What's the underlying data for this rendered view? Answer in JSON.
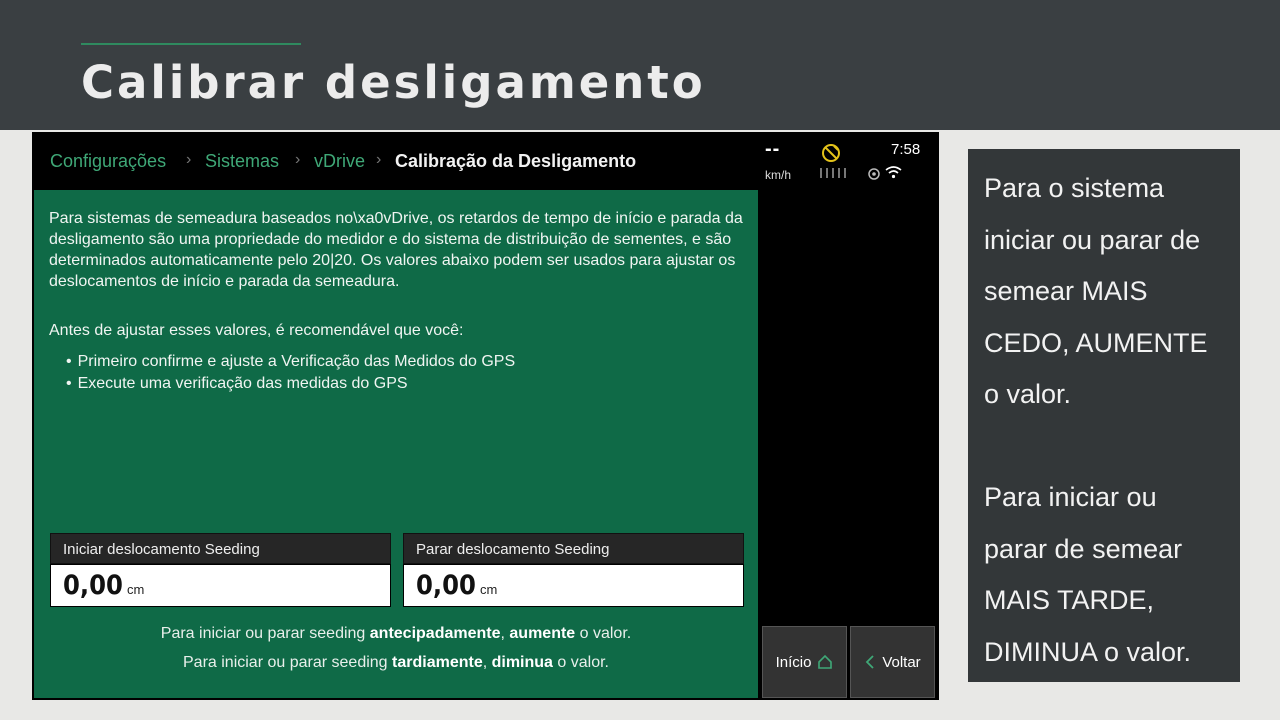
{
  "slide": {
    "title": "Calibrar desligamento"
  },
  "breadcrumb": {
    "items": [
      "Configurações",
      "Sistemas",
      "vDrive"
    ],
    "current": "Calibração da Desligamento",
    "separator": "›"
  },
  "status": {
    "speed": "--",
    "speed_unit": "km/h",
    "time": "7:58"
  },
  "content": {
    "intro": "Para sistemas de semeadura baseados no\\xa0vDrive, os retardos de tempo de início e parada da desligamento são uma propriedade do medidor e do sistema de distribuição de sementes, e são determinados automaticamente pelo 20|20. Os valores abaixo podem ser usados para ajustar os deslocamentos de início e parada da semeadura.",
    "before": "Antes de ajustar esses valores, é recomendável que você:",
    "bullets": [
      "Primeiro confirme e ajuste a Verificação das Medidos do GPS",
      "Execute uma verificação das medidas do GPS"
    ]
  },
  "fields": {
    "start": {
      "label": "Iniciar deslocamento Seeding",
      "value": "0,00",
      "unit": "cm"
    },
    "stop": {
      "label": "Parar deslocamento Seeding",
      "value": "0,00",
      "unit": "cm"
    }
  },
  "hints": {
    "line1": {
      "pre": "Para iniciar ou parar seeding ",
      "b1": "antecipadamente",
      "mid": ", ",
      "b2": "aumente",
      "post": " o valor."
    },
    "line2": {
      "pre": "Para iniciar ou parar seeding ",
      "b1": "tardiamente",
      "mid": ", ",
      "b2": "diminua",
      "post": " o valor."
    }
  },
  "buttons": {
    "home": "Início",
    "back": "Voltar"
  },
  "note": {
    "text": "Para o sistema\niniciar ou parar de\nsemear MAIS\nCEDO, AUMENTE\no valor.\n\n Para iniciar ou\nparar de semear\nMAIS TARDE,\nDIMINUA o valor."
  },
  "colors": {
    "header_bg": "#3a3f42",
    "content_green": "#0f6a47",
    "breadcrumb_green": "#3fa877",
    "gps_yellow": "#e3c21a"
  }
}
